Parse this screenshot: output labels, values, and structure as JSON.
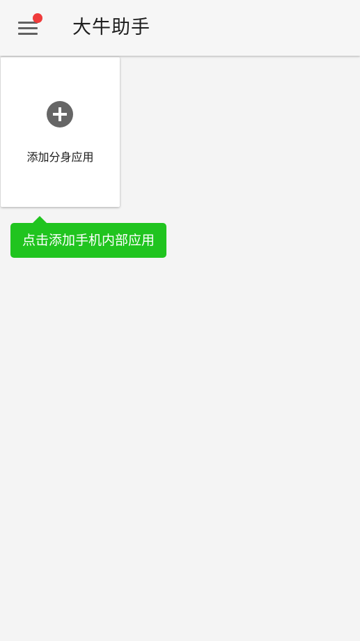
{
  "app_bar": {
    "title": "大牛助手",
    "menu_icon": "hamburger-menu-icon",
    "has_notification_dot": true,
    "notification_dot_color": "#ef3b3b"
  },
  "add_card": {
    "icon": "plus-circle-icon",
    "label": "添加分身应用"
  },
  "tooltip": {
    "text": "点击添加手机内部应用",
    "color": "#20c41f"
  }
}
